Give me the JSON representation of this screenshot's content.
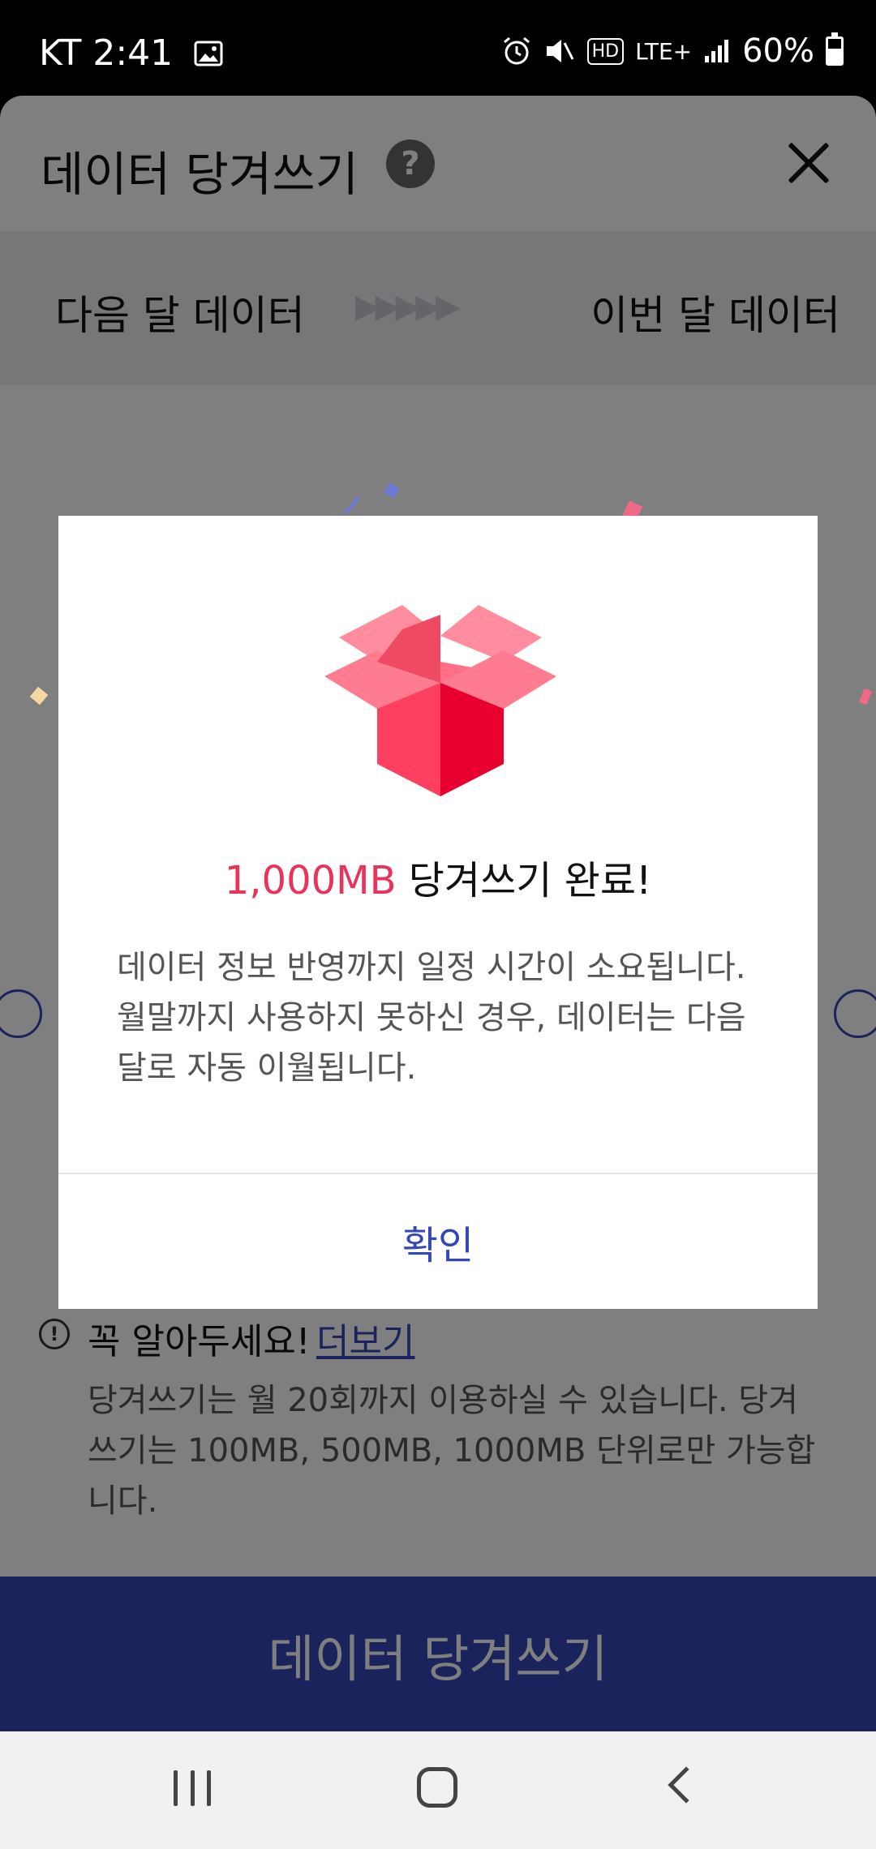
{
  "status_bar": {
    "carrier": "KT",
    "time": "2:41",
    "network": "LTE+",
    "hd_label": "HD",
    "battery": "60%",
    "battery_level": 0.6
  },
  "sheet": {
    "title": "데이터 당겨쓰기",
    "help_icon": "question-icon",
    "close_icon": "close-icon",
    "transfer_from": "다음 달 데이터",
    "transfer_to": "이번 달 데이터"
  },
  "notice": {
    "heading": "꼭 알아두세요!",
    "more_link": "더보기",
    "body": "당겨쓰기는 월 20회까지 이용하실 수 있습니다. 당겨쓰기는 100MB, 500MB, 1000MB 단위로만 가능합니다."
  },
  "cta": {
    "label": "데이터 당겨쓰기"
  },
  "dialog": {
    "amount": "1,000MB",
    "title_rest": " 당겨쓰기 완료!",
    "message": "데이터 정보 반영까지 일정 시간이 소요됩니다. 월말까지 사용하지 못하신 경우, 데이터는 다음달로 자동 이월됩니다.",
    "confirm_label": "확인",
    "accent_color": "#e8345a",
    "button_color": "#3447b9"
  },
  "nav_bar": {
    "recents_icon": "recents-icon",
    "home_icon": "home-icon",
    "back_icon": "back-icon"
  }
}
